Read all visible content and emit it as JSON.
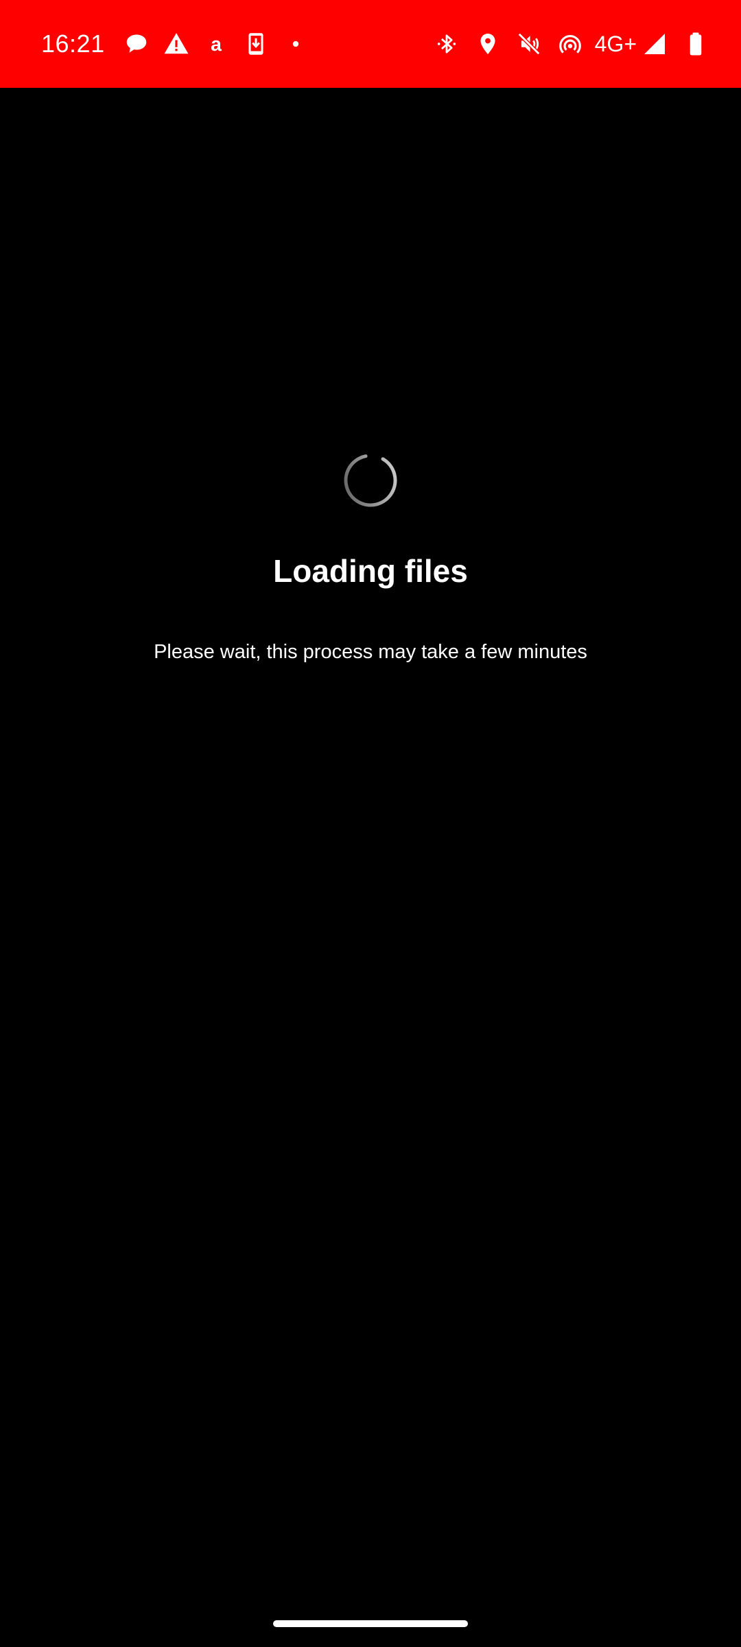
{
  "status_bar": {
    "time": "16:21",
    "network_type": "4G+",
    "background_color": "#ff0000",
    "left_icons": [
      "chat-bubble-icon",
      "warning-icon",
      "amazon-icon",
      "download-phone-icon",
      "dot-icon"
    ],
    "right_icons": [
      "bluetooth-icon",
      "location-icon",
      "vibrate-off-icon",
      "hotspot-icon",
      "signal-icon",
      "battery-icon"
    ]
  },
  "loading": {
    "title": "Loading files",
    "message": "Please wait, this process may take a few minutes"
  },
  "colors": {
    "background": "#000000",
    "text": "#ffffff",
    "accent": "#ff0000"
  }
}
